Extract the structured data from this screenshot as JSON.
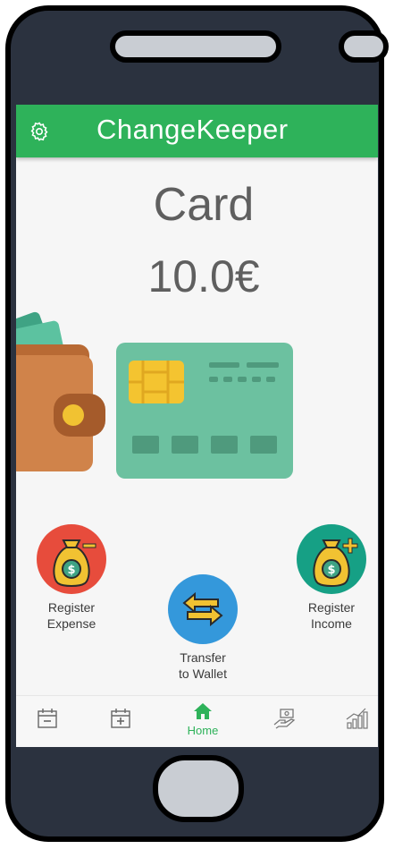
{
  "app": {
    "title": "ChangeKeeper"
  },
  "account": {
    "name": "Card",
    "amount": "10.0€"
  },
  "actions": {
    "register_expense": "Register\nExpense",
    "transfer": "Transfer\nto Wallet",
    "register_income": "Register\nIncome"
  },
  "nav": {
    "items": [
      {
        "icon": "calendar-minus-icon",
        "label": ""
      },
      {
        "icon": "calendar-plus-icon",
        "label": ""
      },
      {
        "icon": "home-icon",
        "label": "Home"
      },
      {
        "icon": "hand-money-icon",
        "label": ""
      },
      {
        "icon": "chart-growth-icon",
        "label": ""
      }
    ]
  },
  "colors": {
    "brand_green": "#2eb25a",
    "expense_red": "#e74c3c",
    "transfer_blue": "#3498db",
    "income_teal": "#16a085"
  }
}
